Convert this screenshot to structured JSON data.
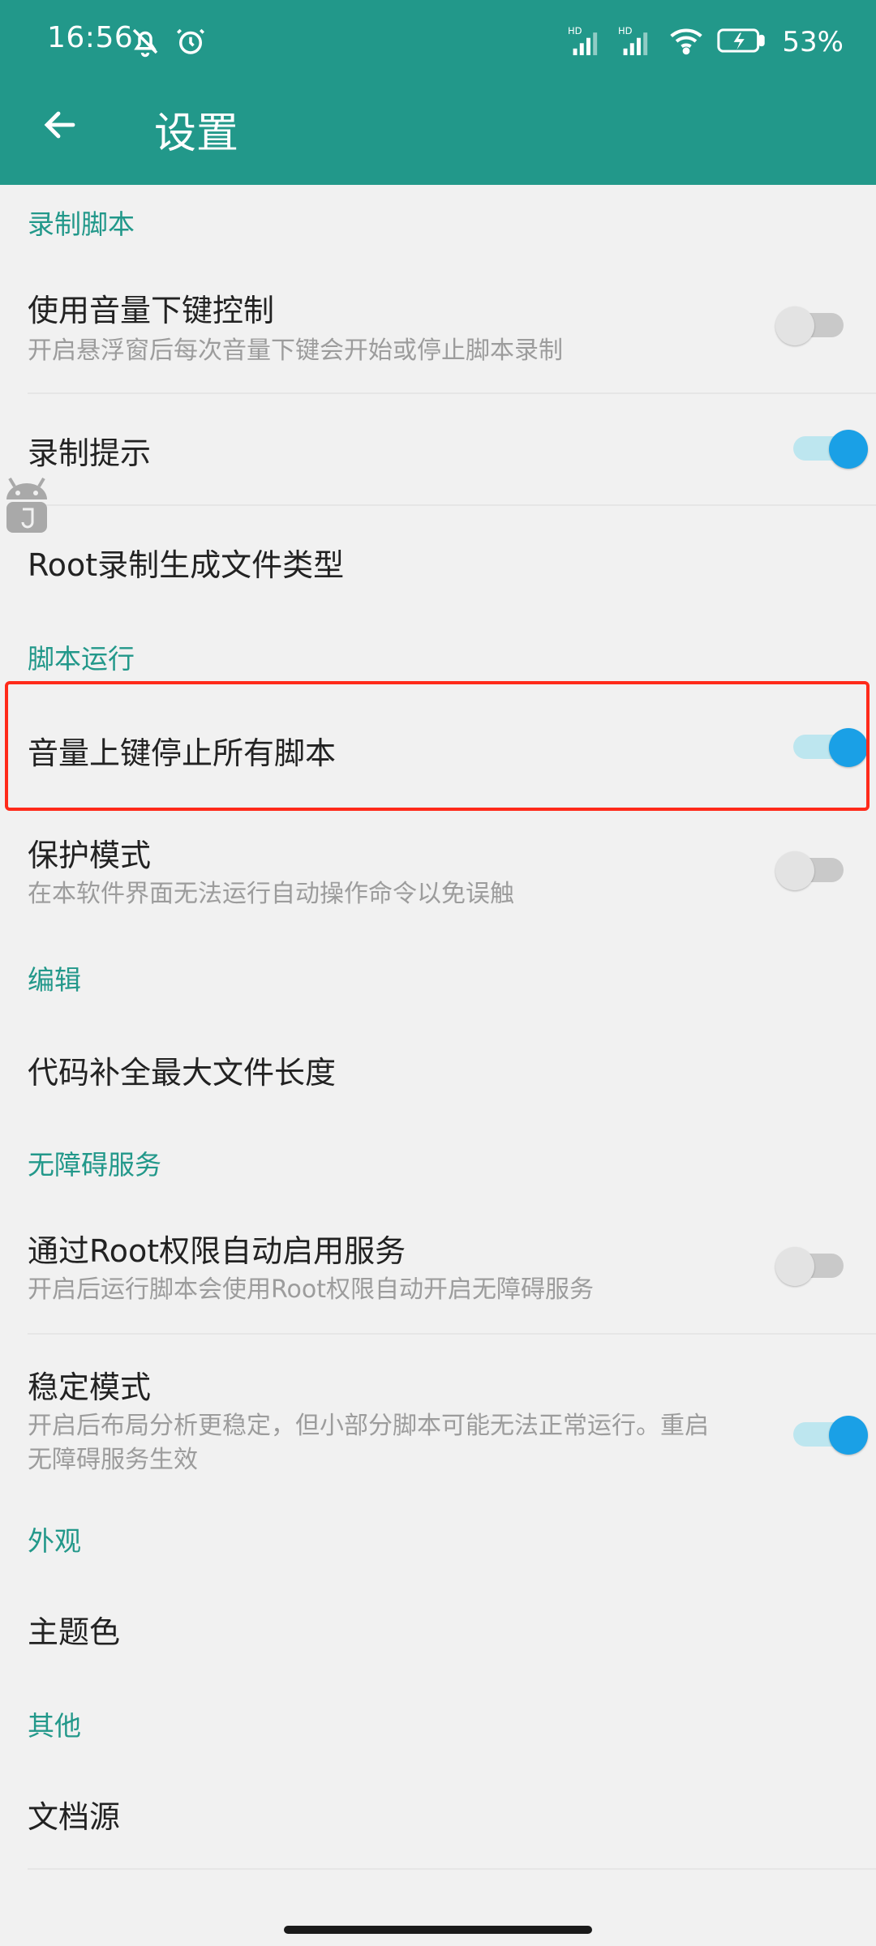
{
  "status_bar": {
    "time": "16:56",
    "battery": "53%"
  },
  "app_bar": {
    "title": "设置"
  },
  "sections": {
    "recording": {
      "header": "录制脚本",
      "volume_down": {
        "title": "使用音量下键控制",
        "subtitle": "开启悬浮窗后每次音量下键会开始或停止脚本录制",
        "enabled": false
      },
      "record_tips": {
        "title": "录制提示",
        "enabled": true
      },
      "root_file_type": {
        "title": "Root录制生成文件类型"
      }
    },
    "running": {
      "header": "脚本运行",
      "volume_up_stop": {
        "title": "音量上键停止所有脚本",
        "enabled": true
      },
      "protect_mode": {
        "title": "保护模式",
        "subtitle": "在本软件界面无法运行自动操作命令以免误触",
        "enabled": false
      }
    },
    "editor": {
      "header": "编辑",
      "max_file_length": {
        "title": "代码补全最大文件长度"
      }
    },
    "accessibility": {
      "header": "无障碍服务",
      "root_auto_enable": {
        "title": "通过Root权限自动启用服务",
        "subtitle": "开启后运行脚本会使用Root权限自动开启无障碍服务",
        "enabled": false
      },
      "stable_mode": {
        "title": "稳定模式",
        "subtitle_line1": "开启后布局分析更稳定，但小部分脚本可能无法正常运行。重启",
        "subtitle_line2": "无障碍服务生效",
        "enabled": true
      }
    },
    "appearance": {
      "header": "外观",
      "theme_color": {
        "title": "主题色"
      }
    },
    "other": {
      "header": "其他",
      "doc_source": {
        "title": "文档源"
      }
    }
  },
  "colors": {
    "primary": "#22988a",
    "switch_on": "#1aa0e6",
    "highlight": "#ff2a1a"
  }
}
